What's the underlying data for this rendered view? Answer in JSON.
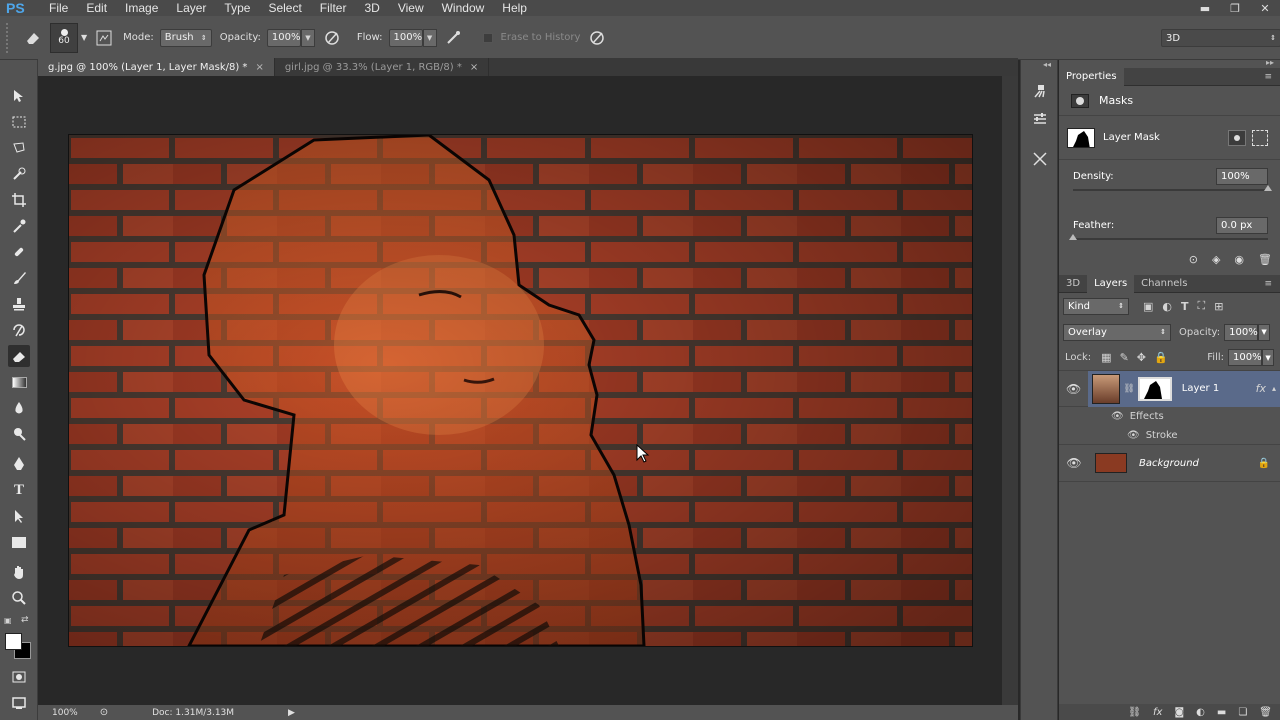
{
  "app": {
    "logo": "PS"
  },
  "menu": [
    "File",
    "Edit",
    "Image",
    "Layer",
    "Type",
    "Select",
    "Filter",
    "3D",
    "View",
    "Window",
    "Help"
  ],
  "window_controls": {
    "minimize": "▬",
    "restore": "❐",
    "close": "✕"
  },
  "options": {
    "brush_size": "60",
    "mode_label": "Mode:",
    "mode_value": "Brush",
    "opacity_label": "Opacity:",
    "opacity_value": "100%",
    "flow_label": "Flow:",
    "flow_value": "100%",
    "erase_history": "Erase to History",
    "workspace": "3D"
  },
  "tabs": [
    {
      "label": "g.jpg @ 100% (Layer 1, Layer Mask/8) *",
      "close": "×"
    },
    {
      "label": "girl.jpg @ 33.3% (Layer 1, RGB/8) *",
      "close": "×"
    }
  ],
  "status": {
    "zoom": "100%",
    "doc": "Doc: 1.31M/3.13M"
  },
  "properties": {
    "title": "Properties",
    "section": "Masks",
    "mask_label": "Layer Mask",
    "density_label": "Density:",
    "density_value": "100%",
    "density": 1.0,
    "feather_label": "Feather:",
    "feather_value": "0.0 px",
    "feather": 0.0
  },
  "layers_panel": {
    "tabs": [
      "3D",
      "Layers",
      "Channels"
    ],
    "active_tab": "Layers",
    "kind": "Kind",
    "blend_mode": "Overlay",
    "opacity_label": "Opacity:",
    "opacity_value": "100%",
    "lock_label": "Lock:",
    "fill_label": "Fill:",
    "fill_value": "100%",
    "layers": [
      {
        "name": "Layer 1",
        "fx": "fx",
        "effects_label": "Effects",
        "stroke_label": "Stroke"
      },
      {
        "name": "Background"
      }
    ]
  },
  "colors": {
    "accent": "#4ea6ea",
    "brick": "#b4432a",
    "mortar": "#4f3e35",
    "selected_layer": "#5a6a8a"
  }
}
